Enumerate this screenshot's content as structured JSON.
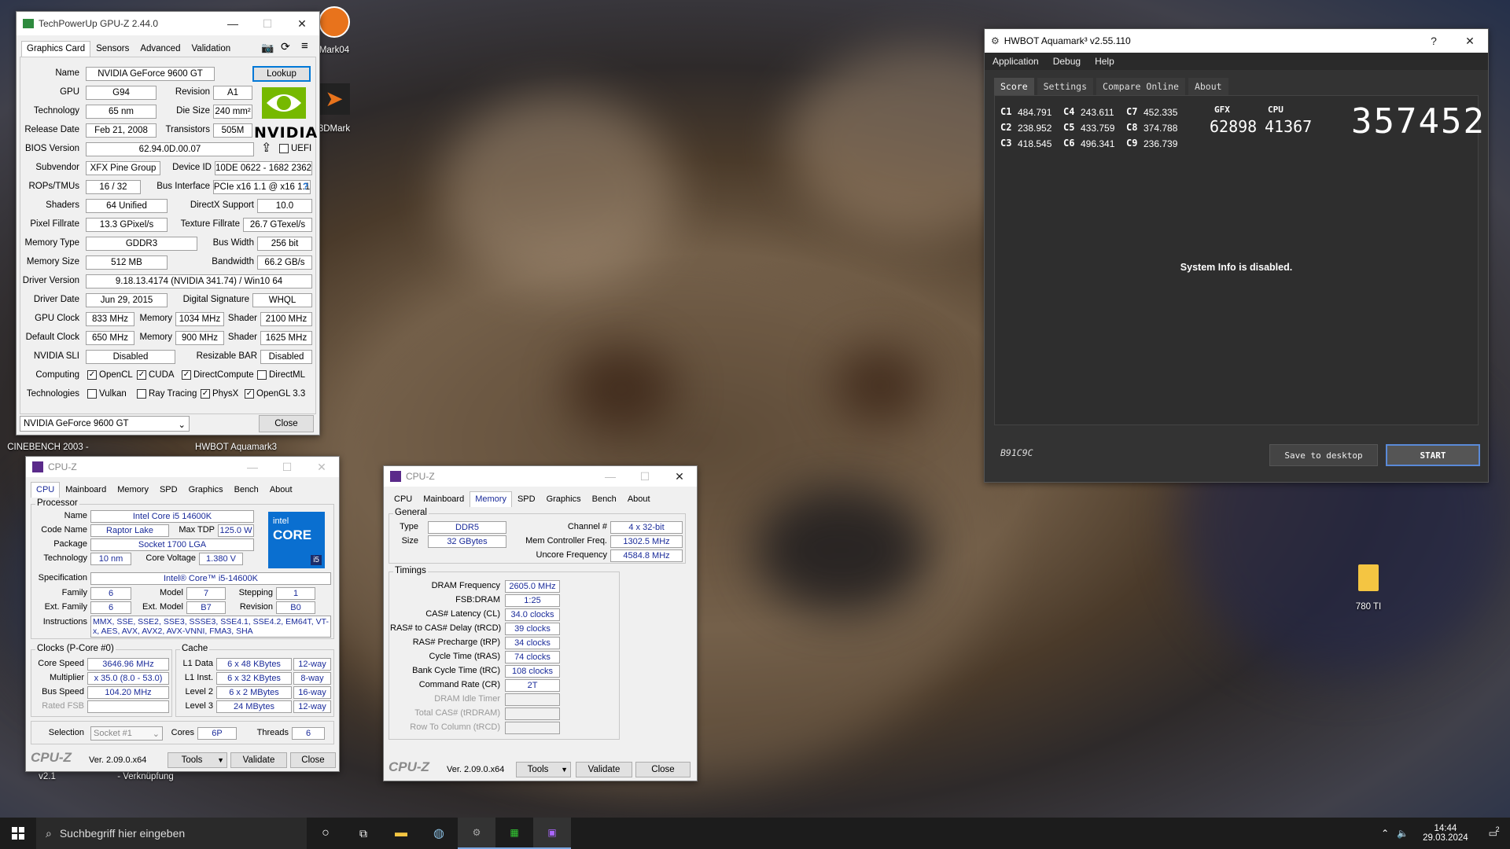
{
  "gpuz": {
    "title": "TechPowerUp GPU-Z 2.44.0",
    "tabs": [
      "Graphics Card",
      "Sensors",
      "Advanced",
      "Validation"
    ],
    "labels": {
      "name": "Name",
      "gpu": "GPU",
      "revision": "Revision",
      "technology": "Technology",
      "die_size": "Die Size",
      "release_date": "Release Date",
      "transistors": "Transistors",
      "bios": "BIOS Version",
      "uefi": "UEFI",
      "subvendor": "Subvendor",
      "device_id": "Device ID",
      "rops": "ROPs/TMUs",
      "bus_if": "Bus Interface",
      "shaders": "Shaders",
      "dx": "DirectX Support",
      "pixel": "Pixel Fillrate",
      "texture": "Texture Fillrate",
      "memtype": "Memory Type",
      "buswidth": "Bus Width",
      "memsize": "Memory Size",
      "bandwidth": "Bandwidth",
      "driver": "Driver Version",
      "driverdate": "Driver Date",
      "digsig": "Digital Signature",
      "gpuclock": "GPU Clock",
      "memory": "Memory",
      "shader": "Shader",
      "defclock": "Default Clock",
      "sli": "NVIDIA SLI",
      "rebar": "Resizable BAR",
      "computing": "Computing",
      "technologies": "Technologies"
    },
    "values": {
      "name": "NVIDIA GeForce 9600 GT",
      "gpu": "G94",
      "revision": "A1",
      "technology": "65 nm",
      "die_size": "240 mm²",
      "release_date": "Feb 21, 2008",
      "transistors": "505M",
      "bios": "62.94.0D.00.07",
      "subvendor": "XFX Pine Group",
      "device_id": "10DE 0622 - 1682 2362",
      "rops": "16 / 32",
      "bus_if": "PCIe x16 1.1 @ x16 1.1",
      "shaders": "64 Unified",
      "dx": "10.0",
      "pixel": "13.3 GPixel/s",
      "texture": "26.7 GTexel/s",
      "memtype": "GDDR3",
      "buswidth": "256 bit",
      "memsize": "512 MB",
      "bandwidth": "66.2 GB/s",
      "driver": "9.18.13.4174 (NVIDIA 341.74) / Win10 64",
      "driverdate": "Jun 29, 2015",
      "digsig": "WHQL",
      "gpuclock": "833 MHz",
      "gpumem": "1034 MHz",
      "gpushader": "2100 MHz",
      "defclock": "650 MHz",
      "defmem": "900 MHz",
      "defshader": "1625 MHz",
      "sli": "Disabled",
      "rebar": "Disabled"
    },
    "computing": [
      "OpenCL",
      "CUDA",
      "DirectCompute",
      "DirectML"
    ],
    "technologies": [
      "Vulkan",
      "Ray Tracing",
      "PhysX",
      "OpenGL 3.3"
    ],
    "lookup": "Lookup",
    "close": "Close",
    "selected_gpu": "NVIDIA GeForce 9600 GT",
    "logo_text": "NVIDIA",
    "help": "?"
  },
  "cpuz1": {
    "title": "CPU-Z",
    "tabs": [
      "CPU",
      "Mainboard",
      "Memory",
      "SPD",
      "Graphics",
      "Bench",
      "About"
    ],
    "processor": "Processor",
    "labels": {
      "name": "Name",
      "codename": "Code Name",
      "maxtdp": "Max TDP",
      "package": "Package",
      "technology": "Technology",
      "corevoltage": "Core Voltage",
      "spec": "Specification",
      "family": "Family",
      "model": "Model",
      "stepping": "Stepping",
      "extfamily": "Ext. Family",
      "extmodel": "Ext. Model",
      "revision": "Revision",
      "instructions": "Instructions"
    },
    "values": {
      "name": "Intel Core i5 14600K",
      "codename": "Raptor Lake",
      "maxtdp": "125.0 W",
      "package": "Socket 1700 LGA",
      "technology": "10 nm",
      "corevoltage": "1.380 V",
      "spec": "Intel® Core™ i5-14600K",
      "family": "6",
      "model": "7",
      "stepping": "1",
      "extfamily": "6",
      "extmodel": "B7",
      "revision": "B0",
      "instructions": "MMX, SSE, SSE2, SSE3, SSSE3, SSE4.1, SSE4.2, EM64T, VT-x, AES, AVX, AVX2, AVX-VNNI, FMA3, SHA"
    },
    "clocks_title": "Clocks (P-Core #0)",
    "clocks": {
      "corespeed_l": "Core Speed",
      "corespeed": "3646.96 MHz",
      "mult_l": "Multiplier",
      "mult": "x 35.0 (8.0 - 53.0)",
      "bus_l": "Bus Speed",
      "bus": "104.20 MHz",
      "fsb_l": "Rated FSB"
    },
    "cache_title": "Cache",
    "cache": [
      [
        "L1 Data",
        "6 x 48 KBytes",
        "12-way"
      ],
      [
        "L1 Inst.",
        "6 x 32 KBytes",
        "8-way"
      ],
      [
        "Level 2",
        "6 x 2 MBytes",
        "16-way"
      ],
      [
        "Level 3",
        "24 MBytes",
        "12-way"
      ]
    ],
    "selection_l": "Selection",
    "selection": "Socket #1",
    "cores_l": "Cores",
    "cores": "6P",
    "threads_l": "Threads",
    "threads": "6",
    "logo": "CPU-Z",
    "version": "Ver. 2.09.0.x64",
    "tools": "Tools",
    "validate": "Validate",
    "close": "Close",
    "intel": "intel",
    "core": "CORE",
    "i5": "i5"
  },
  "cpuz2": {
    "title": "CPU-Z",
    "tabs": [
      "CPU",
      "Mainboard",
      "Memory",
      "SPD",
      "Graphics",
      "Bench",
      "About"
    ],
    "general": "General",
    "type_l": "Type",
    "type": "DDR5",
    "channel_l": "Channel #",
    "channel": "4 x 32-bit",
    "size_l": "Size",
    "size": "32 GBytes",
    "mcf_l": "Mem Controller Freq.",
    "mcf": "1302.5 MHz",
    "uncore_l": "Uncore Frequency",
    "uncore": "4584.8 MHz",
    "timings": "Timings",
    "rows": [
      [
        "DRAM Frequency",
        "2605.0 MHz"
      ],
      [
        "FSB:DRAM",
        "1:25"
      ],
      [
        "CAS# Latency (CL)",
        "34.0 clocks"
      ],
      [
        "RAS# to CAS# Delay (tRCD)",
        "39 clocks"
      ],
      [
        "RAS# Precharge (tRP)",
        "34 clocks"
      ],
      [
        "Cycle Time (tRAS)",
        "74 clocks"
      ],
      [
        "Bank Cycle Time (tRC)",
        "108 clocks"
      ],
      [
        "Command Rate (CR)",
        "2T"
      ],
      [
        "DRAM Idle Timer",
        ""
      ],
      [
        "Total CAS# (tRDRAM)",
        ""
      ],
      [
        "Row To Column (tRCD)",
        ""
      ]
    ],
    "logo": "CPU-Z",
    "version": "Ver. 2.09.0.x64",
    "tools": "Tools",
    "validate": "Validate",
    "close": "Close"
  },
  "aquamark": {
    "title": "HWBOT Aquamark³ v2.55.110",
    "menu": [
      "Application",
      "Debug",
      "Help"
    ],
    "tabs": [
      "Score",
      "Settings",
      "Compare Online",
      "About"
    ],
    "scores": [
      [
        "C1",
        "484.791"
      ],
      [
        "C2",
        "238.952"
      ],
      [
        "C3",
        "418.545"
      ],
      [
        "C4",
        "243.611"
      ],
      [
        "C5",
        "433.759"
      ],
      [
        "C6",
        "496.341"
      ],
      [
        "C7",
        "452.335"
      ],
      [
        "C8",
        "374.788"
      ],
      [
        "C9",
        "236.739"
      ]
    ],
    "gfx_l": "GFX",
    "gfx": "62898",
    "cpu_l": "CPU",
    "cpu": "41367",
    "total": "357452",
    "sysinfo": "System Info is disabled.",
    "code": "B91C9C",
    "save": "Save to desktop",
    "start": "START",
    "help": "?"
  },
  "desktop": {
    "icons": [
      "Mark04",
      "3DMark",
      "CINEBENCH 2003 -",
      "HWBOT Aquamark3",
      "780 TI",
      "- Verknüpfung",
      "v2.1"
    ]
  },
  "taskbar": {
    "search": "Suchbegriff hier eingeben",
    "time": "14:44",
    "date": "29.03.2024",
    "notif": "2"
  }
}
